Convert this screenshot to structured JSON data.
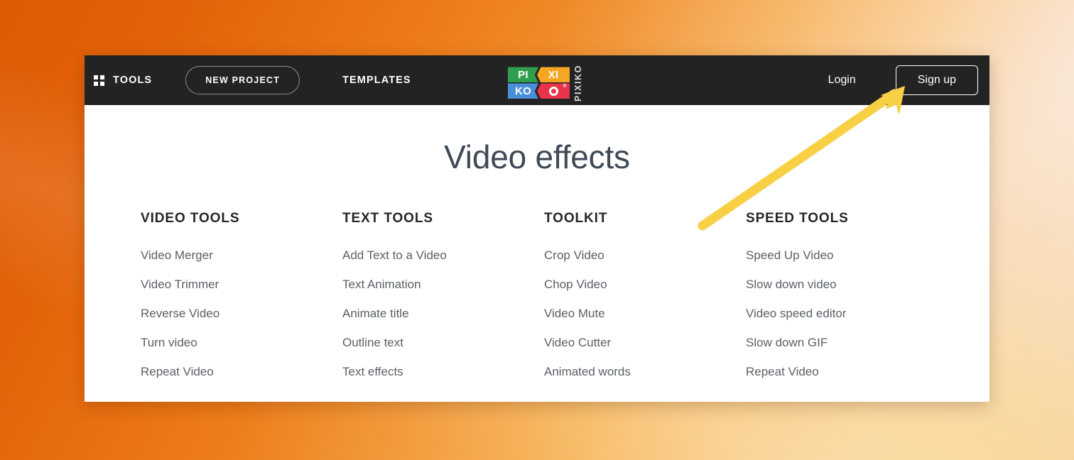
{
  "navbar": {
    "tools_label": "TOOLS",
    "tools_icon": "grid-2x2-icon",
    "new_project_label": "NEW PROJECT",
    "templates_label": "TEMPLATES",
    "login_label": "Login",
    "signup_label": "Sign up",
    "background_color": "#232323"
  },
  "logo": {
    "tile_1": "PI",
    "tile_2": "XI",
    "tile_3": "KO",
    "tile_4_icon": "o-ring-icon",
    "registered_mark": "®",
    "wordmark_vertical": "PIXIKO",
    "colors": {
      "green": "#2F9E4F",
      "orange": "#F5A623",
      "blue": "#4A90D9",
      "red": "#E8334A"
    }
  },
  "main": {
    "title": "Video effects",
    "title_color": "#3F4A56",
    "columns": [
      {
        "heading": "VIDEO TOOLS",
        "links": [
          "Video Merger",
          "Video Trimmer",
          "Reverse Video",
          "Turn video",
          "Repeat Video"
        ]
      },
      {
        "heading": "TEXT TOOLS",
        "links": [
          "Add Text to a Video",
          "Text Animation",
          "Animate title",
          "Outline text",
          "Text effects"
        ]
      },
      {
        "heading": "TOOLKIT",
        "links": [
          "Crop Video",
          "Chop Video",
          "Video Mute",
          "Video Cutter",
          "Animated words"
        ]
      },
      {
        "heading": "SPEED TOOLS",
        "links": [
          "Speed Up Video",
          "Slow down video",
          "Video speed editor",
          "Slow down GIF",
          "Repeat Video"
        ]
      }
    ]
  },
  "annotation": {
    "arrow_color": "#F7D046",
    "points_to": "Sign up"
  }
}
